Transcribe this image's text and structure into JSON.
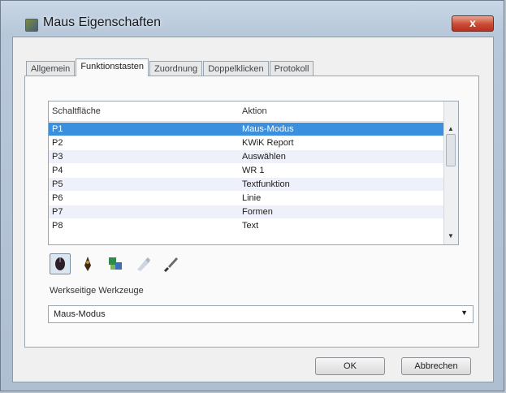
{
  "window": {
    "title": "Maus Eigenschaften",
    "close_label": "x"
  },
  "tabs": [
    {
      "label": "Allgemein",
      "active": false
    },
    {
      "label": "Funktionstasten",
      "active": true
    },
    {
      "label": "Zuordnung",
      "active": false
    },
    {
      "label": "Doppelklicken",
      "active": false
    },
    {
      "label": "Protokoll",
      "active": false
    }
  ],
  "list": {
    "columns": {
      "key": "Schaltfläche",
      "action": "Aktion"
    },
    "rows": [
      {
        "key": "P1",
        "action": "Maus-Modus",
        "selected": true
      },
      {
        "key": "P2",
        "action": "KWiK Report",
        "selected": false
      },
      {
        "key": "P3",
        "action": "Auswählen",
        "selected": false
      },
      {
        "key": "P4",
        "action": "WR 1",
        "selected": false
      },
      {
        "key": "P5",
        "action": "Textfunktion",
        "selected": false
      },
      {
        "key": "P6",
        "action": "Linie",
        "selected": false
      },
      {
        "key": "P7",
        "action": "Formen",
        "selected": false
      },
      {
        "key": "P8",
        "action": "Text",
        "selected": false
      }
    ]
  },
  "toolbar": {
    "icons": [
      "mouse-mode-icon",
      "pen-tool-icon",
      "palette-icon",
      "highlighter-icon",
      "brush-icon"
    ]
  },
  "werkzeug": {
    "label": "Werkseitige Werkzeuge",
    "value": "Maus-Modus"
  },
  "buttons": {
    "ok": "OK",
    "cancel": "Abbrechen"
  }
}
